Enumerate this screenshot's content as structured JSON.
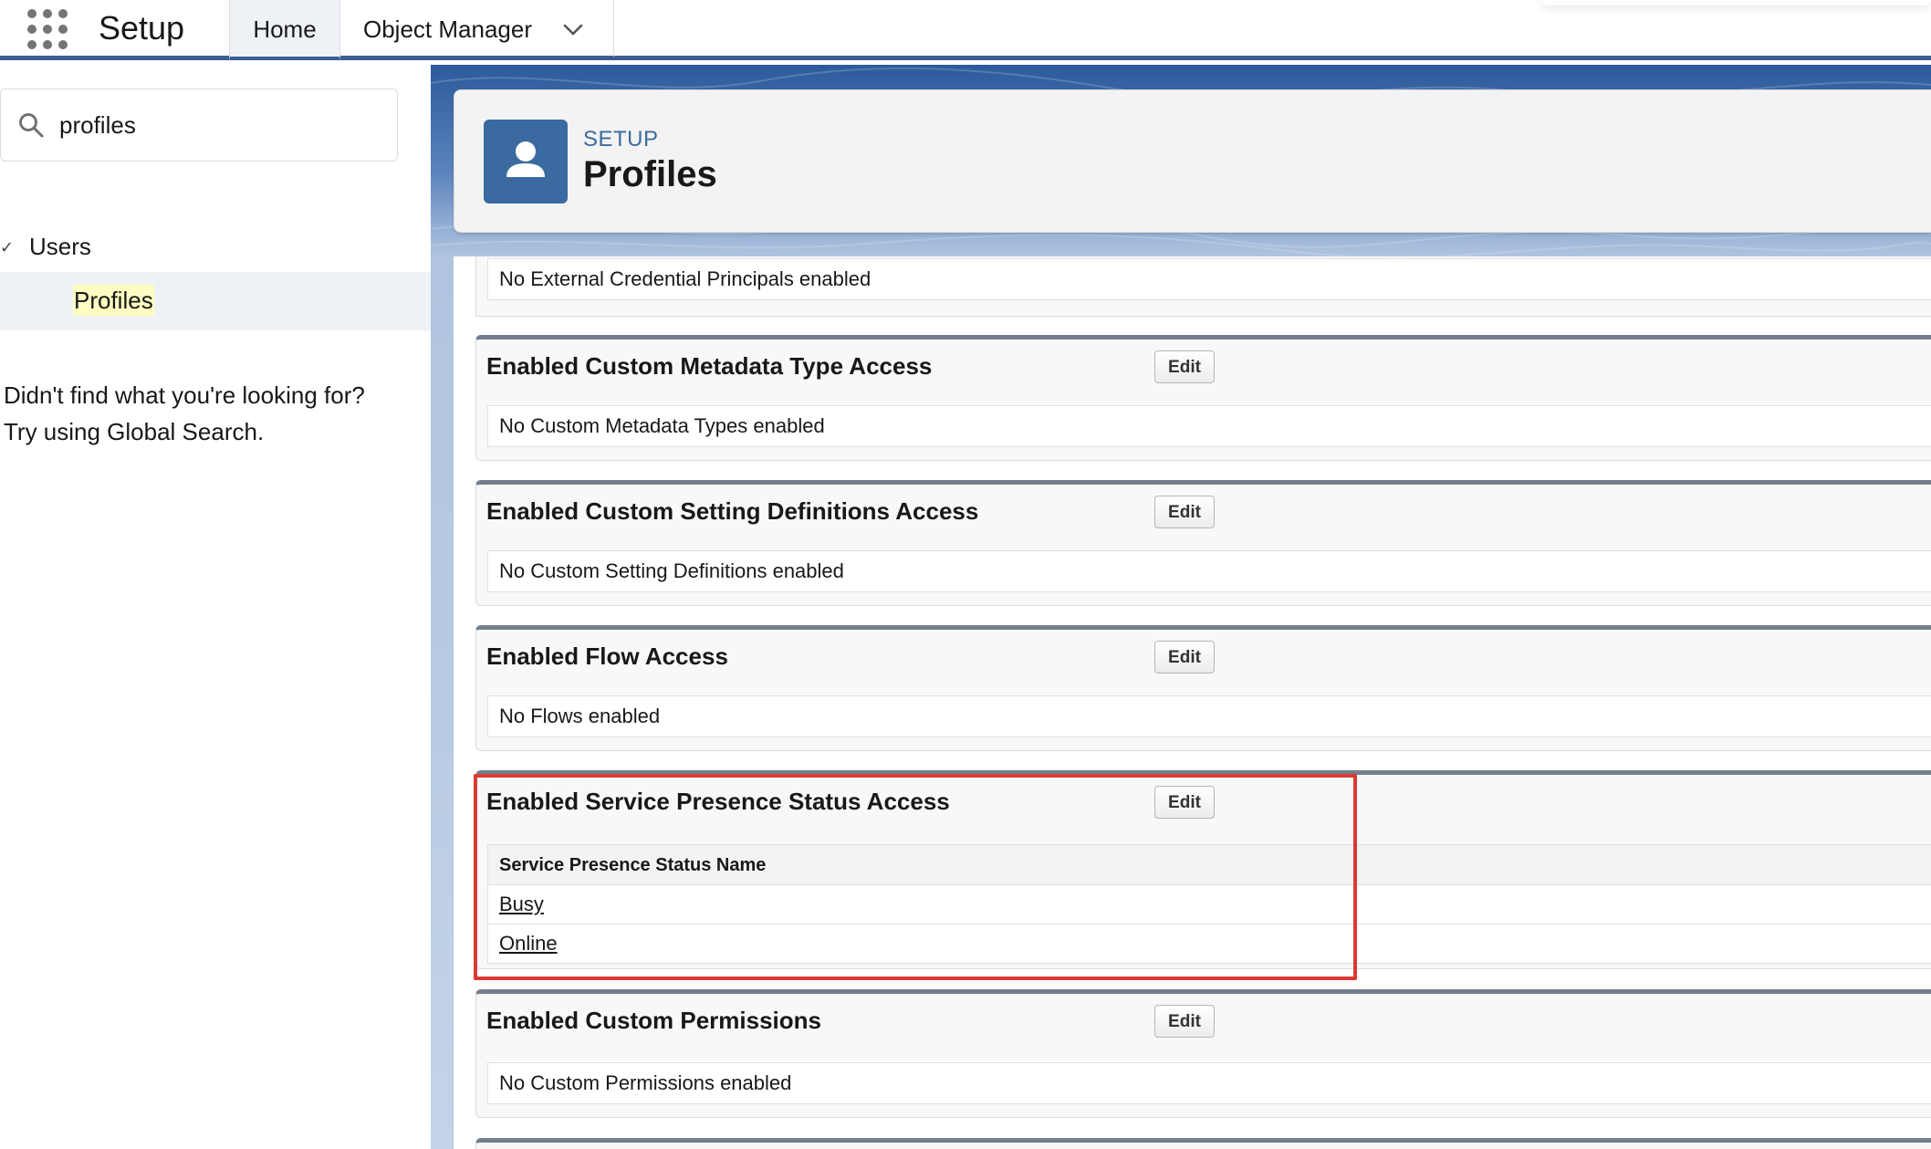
{
  "topbar": {
    "app_title": "Setup",
    "tabs": [
      {
        "label": "Home",
        "active": true
      },
      {
        "label": "Object Manager",
        "active": false
      }
    ]
  },
  "sidebar": {
    "search": {
      "value": "profiles",
      "placeholder": ""
    },
    "tree": {
      "parent_label": "Users",
      "child_label": "Profiles"
    },
    "not_found_line1": "Didn't find what you're looking for?",
    "not_found_line2": "Try using Global Search."
  },
  "header": {
    "eyebrow": "SETUP",
    "title": "Profiles"
  },
  "sections": {
    "external_credentials": {
      "empty_text": "No External Credential Principals enabled"
    },
    "custom_metadata": {
      "title": "Enabled Custom Metadata Type Access",
      "edit_label": "Edit",
      "empty_text": "No Custom Metadata Types enabled"
    },
    "custom_settings": {
      "title": "Enabled Custom Setting Definitions Access",
      "edit_label": "Edit",
      "empty_text": "No Custom Setting Definitions enabled"
    },
    "flow_access": {
      "title": "Enabled Flow Access",
      "edit_label": "Edit",
      "empty_text": "No Flows enabled"
    },
    "service_presence": {
      "title": "Enabled Service Presence Status Access",
      "edit_label": "Edit",
      "column_header": "Service Presence Status Name",
      "rows": [
        "Busy",
        "Online"
      ]
    },
    "custom_permissions": {
      "title": "Enabled Custom Permissions",
      "edit_label": "Edit",
      "empty_text": "No Custom Permissions enabled"
    }
  },
  "colors": {
    "brand_bar": "#3b5f93",
    "header_icon": "#3a6aa0",
    "highlight": "#d93a33",
    "search_highlight": "#fdfdc2"
  },
  "icons": {
    "app_launcher": "waffle-icon",
    "search": "search-icon",
    "tab_menu": "chevron-down-icon",
    "header": "user-icon",
    "tree_expanded": "check-icon"
  }
}
